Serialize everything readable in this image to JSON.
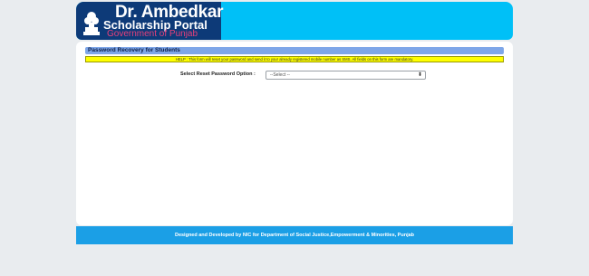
{
  "brand": {
    "title": "Dr. Ambedkar",
    "subtitle": "Scholarship Portal",
    "government": "Government of Punjab"
  },
  "page": {
    "section_title": "Password Recovery for Students",
    "help_text": "HELP : This form will reset your password and send it to your already registered mobile number as SMS. All fields on this form are mandatory."
  },
  "form": {
    "reset_option_label": "Select Reset Password Option :",
    "reset_option_selected": "--Select --"
  },
  "footer": {
    "text": "Designed and Developed by NIC for Department of Social Justice,Empowerment & Minorities, Punjab"
  },
  "colors": {
    "header_bg": "#00c0f7",
    "brand_bg": "#0d3a78",
    "help_bg": "#ffff00",
    "section_bar": "#7ea6e8",
    "footer_bg": "#1b9fe6"
  },
  "icons": {
    "emblem": "state-emblem-icon",
    "select_arrow": "updown-arrow-icon"
  }
}
